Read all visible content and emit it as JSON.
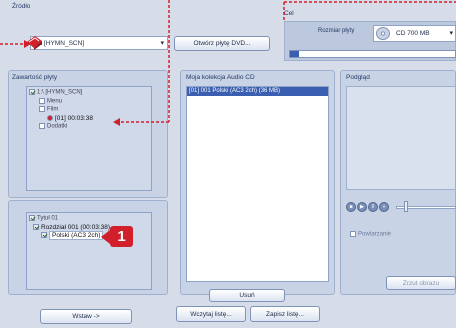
{
  "source": {
    "label": "Źródło",
    "drive_value": "1:\\ [HYMN_SCN]",
    "open_button": "Otwórz płytę DVD..."
  },
  "target": {
    "label": "Cel",
    "size_label": "Rozmiar płyty",
    "disc_value": "CD 700 MB"
  },
  "disc_contents": {
    "label": "Zawartość płyty",
    "tree": [
      "1:\\ [HYMN_SCN]",
      "Menu",
      "Film",
      "[01] 00:03:38",
      "Dodatki"
    ]
  },
  "collection": {
    "label": "Moja kolekcja Audio CD",
    "items": [
      "[01] 001 Polski (AC3 2ch) (36 MB)"
    ]
  },
  "preview": {
    "label": "Podgląd",
    "repeat_label": "Powtarzanie",
    "snapshot_button": "Zrzut obrazu"
  },
  "titles": {
    "tree": [
      "Tytuł 01",
      "Rozdział 001 (00:03:38)",
      "Polski (AC3 2ch)"
    ]
  },
  "buttons": {
    "insert": "Wstaw ->",
    "remove": "Usuń",
    "load_list": "Wczytaj listę...",
    "save_list": "Zapisz listę..."
  },
  "callout": {
    "number": "1"
  },
  "colors": {
    "accent_red": "#d2202a",
    "selection": "#3a5fb0",
    "panel": "#c8d3e5"
  }
}
